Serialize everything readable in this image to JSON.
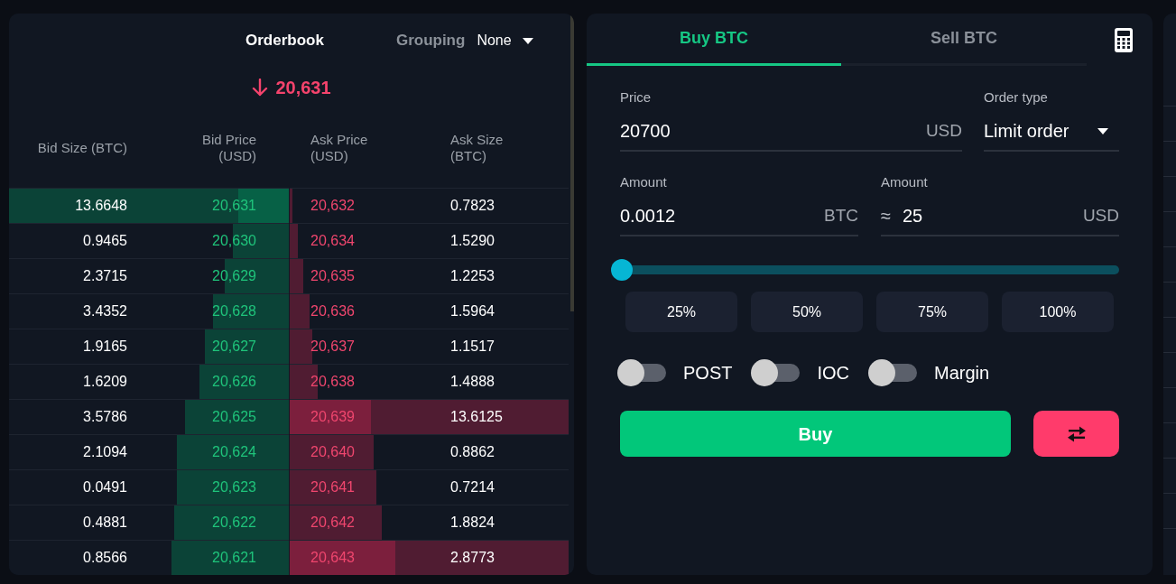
{
  "orderbook": {
    "title": "Orderbook",
    "grouping": {
      "label": "Grouping",
      "value": "None"
    },
    "last_price": {
      "value": "20,631",
      "falling": true
    },
    "columns": [
      "Bid Size (BTC)",
      "Bid Price (USD)",
      "Ask Price (USD)",
      "Ask Size (BTC)"
    ],
    "rows": [
      {
        "bid_size": "13.6648",
        "bid_price": "20,631",
        "ask_price": "20,632",
        "ask_size": "0.7823",
        "bid_depth": {
          "level": 0.18
        },
        "bid_volume": {
          "level": 1
        },
        "ask_depth": {
          "level": 0.01
        }
      },
      {
        "bid_size": "0.9465",
        "bid_price": "20,630",
        "ask_price": "20,634",
        "ask_size": "1.5290",
        "bid_depth": {
          "level": 0.2
        },
        "ask_depth": {
          "level": 0.03
        }
      },
      {
        "bid_size": "2.3715",
        "bid_price": "20,629",
        "ask_price": "20,635",
        "ask_size": "1.2253",
        "bid_depth": {
          "level": 0.23
        },
        "ask_depth": {
          "level": 0.05
        }
      },
      {
        "bid_size": "3.4352",
        "bid_price": "20,628",
        "ask_price": "20,636",
        "ask_size": "1.5964",
        "bid_depth": {
          "level": 0.27
        },
        "ask_depth": {
          "level": 0.07
        }
      },
      {
        "bid_size": "1.9165",
        "bid_price": "20,627",
        "ask_price": "20,637",
        "ask_size": "1.1517",
        "bid_depth": {
          "level": 0.3
        },
        "ask_depth": {
          "level": 0.08
        }
      },
      {
        "bid_size": "1.6209",
        "bid_price": "20,626",
        "ask_price": "20,638",
        "ask_size": "1.4888",
        "bid_depth": {
          "level": 0.32
        },
        "ask_depth": {
          "level": 0.1
        }
      },
      {
        "bid_size": "3.5786",
        "bid_price": "20,625",
        "ask_price": "20,639",
        "ask_size": "13.6125",
        "bid_depth": {
          "level": 0.37
        },
        "ask_depth": {
          "level": 0.29
        },
        "ask_volume": {
          "level": 1
        }
      },
      {
        "bid_size": "2.1094",
        "bid_price": "20,624",
        "ask_price": "20,640",
        "ask_size": "0.8862",
        "bid_depth": {
          "level": 0.4
        },
        "ask_depth": {
          "level": 0.3
        }
      },
      {
        "bid_size": "0.0491",
        "bid_price": "20,623",
        "ask_price": "20,641",
        "ask_size": "0.7214",
        "bid_depth": {
          "level": 0.4
        },
        "ask_depth": {
          "level": 0.31
        }
      },
      {
        "bid_size": "0.4881",
        "bid_price": "20,622",
        "ask_price": "20,642",
        "ask_size": "1.8824",
        "bid_depth": {
          "level": 0.41
        },
        "ask_depth": {
          "level": 0.33
        }
      },
      {
        "bid_size": "0.8566",
        "bid_price": "20,621",
        "ask_price": "20,643",
        "ask_size": "2.8773",
        "bid_depth": {
          "level": 0.42
        },
        "ask_depth": {
          "level": 0.38
        },
        "ask_volume": {
          "level": 1
        }
      }
    ]
  },
  "order_form": {
    "tabs": [
      {
        "label": "Buy BTC",
        "selected": true
      },
      {
        "label": "Sell BTC",
        "selected": false
      }
    ],
    "price": {
      "label": "Price",
      "value": "20700",
      "unit": "USD"
    },
    "order_type": {
      "label": "Order type",
      "value": "Limit order"
    },
    "amount": {
      "label": "Amount",
      "value": "0.0012",
      "unit": "BTC"
    },
    "total": {
      "label": "Amount",
      "prefix": "≈",
      "value": "25",
      "unit": "USD"
    },
    "slider": {
      "level": 0
    },
    "presets": [
      "25%",
      "50%",
      "75%",
      "100%"
    ],
    "toggles": [
      {
        "label": "POST",
        "on": false
      },
      {
        "label": "IOC",
        "on": false
      },
      {
        "label": "Margin",
        "on": false
      }
    ],
    "submit": "Buy"
  }
}
